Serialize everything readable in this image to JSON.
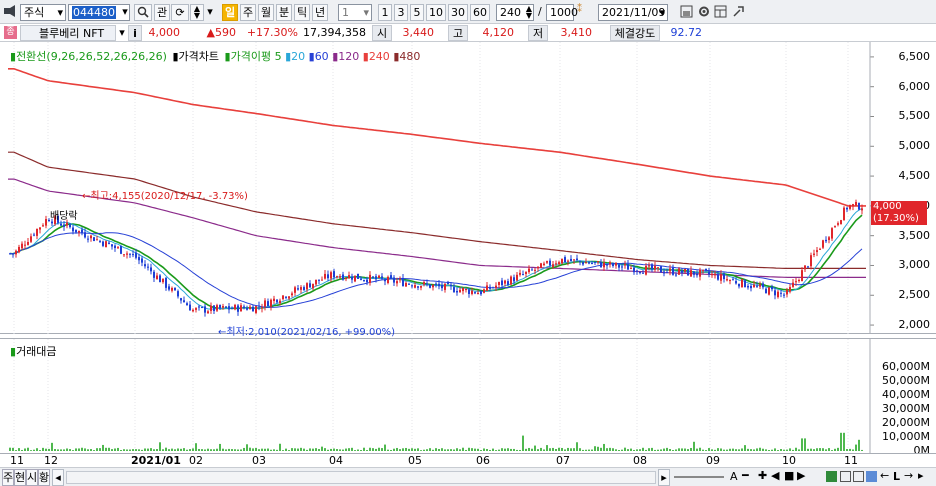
{
  "toolbar": {
    "market_type": "주식",
    "stock_code": "044480",
    "tabs": [
      "관",
      "주",
      "월",
      "분",
      "틱",
      "년"
    ],
    "active_tab": "일",
    "period_value": "1",
    "period_buttons": [
      "1",
      "3",
      "5",
      "10",
      "30",
      "60"
    ],
    "count_value": "240",
    "total_value": "1000",
    "date_value": "2021/11/09"
  },
  "info": {
    "stock_name": "블루베리 NFT",
    "i_button": "i",
    "price": "4,000",
    "change": "▲590",
    "change_rate": "+17.30%",
    "volume": "17,394,358",
    "open_label": "시",
    "open": "3,440",
    "high_label": "고",
    "high": "4,120",
    "low_label": "저",
    "low": "3,410",
    "strength_label": "체결강도",
    "strength": "92.72"
  },
  "legend": {
    "ichimoku": "전환선(9,26,26,52,26,26,26)",
    "price_chart": "가격차트",
    "ma_label": "가격이평",
    "ma_items": [
      "5",
      "20",
      "60",
      "120",
      "240",
      "480"
    ]
  },
  "colors": {
    "up": "#e0262b",
    "down": "#1d3fd6",
    "ichimoku": "#1a9a1a",
    "ma5": "#2aa7d8",
    "ma20": "#2741d6",
    "ma60": "#8b2b8b",
    "ma120": "#e8403c",
    "ma240": "#8b2b2b",
    "ma480": "#e8403c",
    "volume": "#4fb84f"
  },
  "annotations": {
    "high": "←최고:4,155(2020/12/17, -3.73%)",
    "low": "←최저:2,010(2021/02/16, +99.00%)",
    "dividend": "배당락"
  },
  "price_axis": {
    "ticks": [
      "6,500",
      "6,000",
      "5,500",
      "5,000",
      "4,500",
      "4,000",
      "3,500",
      "3,000",
      "2,500",
      "2,000"
    ],
    "current_price": "4,000",
    "current_rate": "(17.30%)"
  },
  "volume_panel": {
    "title": "거래대금",
    "ticks": [
      "60,000M",
      "50,000M",
      "40,000M",
      "30,000M",
      "20,000M",
      "10,000M",
      "0M"
    ]
  },
  "x_axis": {
    "labels": [
      "11",
      "12",
      "2021/01",
      "02",
      "03",
      "04",
      "05",
      "06",
      "07",
      "08",
      "09",
      "10",
      "11"
    ]
  },
  "bottombar": {
    "tabs": [
      "주",
      "현",
      "시",
      "황"
    ]
  },
  "chart_data": {
    "type": "candlestick",
    "xlabel": "",
    "ylabel": "",
    "ylim": [
      1850,
      6750
    ],
    "x": [
      "2020-11",
      "2020-12",
      "2021-01",
      "2021-02",
      "2021-03",
      "2021-04",
      "2021-05",
      "2021-06",
      "2021-07",
      "2021-08",
      "2021-09",
      "2021-10",
      "2021-11"
    ],
    "close_approx": [
      3200,
      3800,
      3150,
      2250,
      2300,
      2850,
      2700,
      2550,
      3100,
      2950,
      2850,
      2500,
      4000
    ],
    "series": [
      {
        "name": "480",
        "values": [
          6300,
          6100,
          5900,
          5700,
          5550,
          5350,
          5200,
          5050,
          4900,
          4700,
          4500,
          4350,
          4000
        ]
      },
      {
        "name": "240",
        "values": [
          4900,
          4650,
          4450,
          4150,
          3900,
          3700,
          3550,
          3400,
          3250,
          3100,
          3000,
          2950,
          2950
        ]
      },
      {
        "name": "120",
        "values": [
          4450,
          4250,
          4050,
          3800,
          3500,
          3300,
          3150,
          3000,
          2950,
          2900,
          2850,
          2800,
          2800
        ]
      }
    ],
    "high_point": {
      "value": 4155,
      "date": "2020/12/17"
    },
    "low_point": {
      "value": 2010,
      "date": "2021/02/16"
    },
    "volume_max_approx": 68000
  }
}
